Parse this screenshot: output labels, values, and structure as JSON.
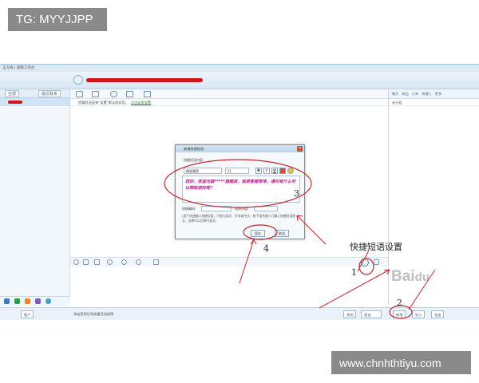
{
  "watermarks": {
    "top_left": "TG: MYYJJPP",
    "bottom_right": "www.chnhthtiyu.com"
  },
  "window": {
    "title": "王方辉 | 掌联工作台"
  },
  "left_panel": {
    "tab_all": "全部",
    "tab_recent": "最近联系"
  },
  "chat": {
    "notice": "您暂时还没有“设置”默认的对话，",
    "notice_link": "点击这里设置"
  },
  "right_panel": {
    "tabs": [
      "聊天",
      "商品",
      "订单",
      "快捷入",
      "更多"
    ],
    "subheader": "未分组"
  },
  "dialog": {
    "title": "新增快捷短语",
    "content_label": "快捷短语内容:",
    "font_name": "微软雅黑",
    "font_size": "11",
    "format_bold": "B",
    "format_italic": "I",
    "format_underline": "U",
    "message_text": "您好，欢迎光临*****旗舰店，我是客服常常，请问有什么可以帮助您的呢？",
    "shortcut_code_label": "快捷编码:",
    "group_label": "选择分组:",
    "note": "(用于快速输入快捷短语，只能为英文、字母或中文，按下组合键入门输入快捷短语首字，选择可以切换中英文)",
    "save_button": "保存",
    "cancel_button": "取消"
  },
  "footer": {
    "left_button": "客户",
    "status_text": "淘宝官网引导流量活动说明",
    "close_button": "关闭",
    "send_button": "发送",
    "new_button": "新增",
    "import_button": "导入",
    "export_button": "导出"
  },
  "annotations": {
    "quick_phrase_setting": "快捷短语设置",
    "step_1": "1",
    "step_2": "2",
    "step_3": "3",
    "step_4": "4"
  },
  "colors": {
    "accent_blue": "#4d87b9",
    "annotation_red": "#c0282d",
    "message_magenta": "#c0128a"
  }
}
